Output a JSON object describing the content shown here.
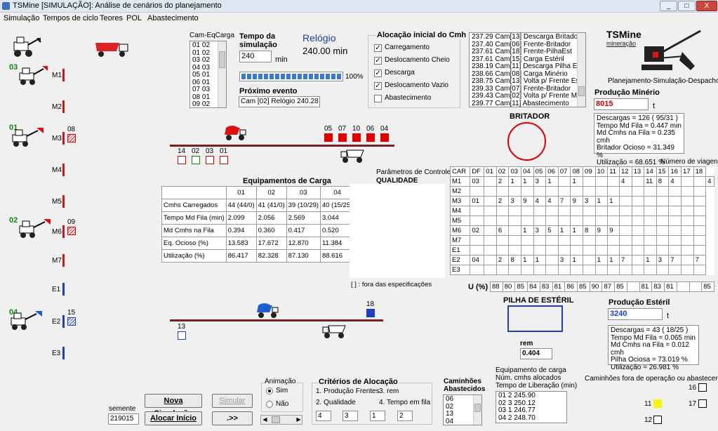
{
  "window": {
    "title": "TSMine [SIMULAÇÃO]: Análise de cenários do planejamento",
    "controls": [
      "_",
      "□",
      "X"
    ]
  },
  "menu": [
    "Simulação",
    "Tempos de ciclo",
    "Teores",
    "POL",
    "Abastecimento"
  ],
  "equip_rows": [
    "M1",
    "M2",
    "M3",
    "M4",
    "M5",
    "M6",
    "M7",
    "E1",
    "E2",
    "E3"
  ],
  "loaders": [
    {
      "id": "03",
      "color": "#0a8a0a"
    },
    {
      "id": "01",
      "color": "#0a8a0a"
    },
    {
      "id": "02",
      "color": "#0a8a0a"
    },
    {
      "id": "04",
      "color": "#0a8a0a"
    }
  ],
  "queue_labels": {
    "m3": "08",
    "m6": "09",
    "e2": "15"
  },
  "cam_eq": {
    "label": "Cam-EqCarga",
    "rows": [
      "01    02",
      "01    02",
      "03    02",
      "04    03",
      "05    01",
      "06    01",
      "07    03",
      "08    01",
      "09    02"
    ]
  },
  "tempo": {
    "label1": "Tempo da",
    "label2": "simulação",
    "value": "240",
    "unit": "min",
    "progress": 100,
    "progress_label": "100%"
  },
  "relogio": {
    "label": "Relógio",
    "value": "240.00 min"
  },
  "proximo": {
    "label": "Próximo evento",
    "value": "Cam [02]    Relógio 240.28"
  },
  "alocacao": {
    "title": "Alocação inicial do Cmh",
    "items": [
      {
        "label": "Carregamento",
        "checked": true
      },
      {
        "label": "Deslocamento Cheio",
        "checked": true
      },
      {
        "label": "Descarga",
        "checked": true
      },
      {
        "label": "Deslocamento Vazio",
        "checked": true
      },
      {
        "label": "Abastecimento",
        "checked": false
      }
    ]
  },
  "events": [
    "237.29  Cam[13]  Descarga Britador",
    "237.40  Cam[06]  Frente-Britador",
    "237.61  Cam[18]  Frente-PilhaEst",
    "237.61  Cam[15]  Carga Estéril",
    "238.19  Cam[11]  Descarga Pilha Est",
    "238.66  Cam[08]  Carga Minério",
    "238.75  Cam[13]  Volta p/ Frente Est",
    "239.33  Cam[07]  Frente-Britador",
    "239.43  Cam[02]  Volta p/ Frente Min",
    "239.77  Cam[11]  Abastecimento"
  ],
  "logo": {
    "name": "TSMine",
    "sub": "mineração",
    "tagline": "Planejamento-Simulação-Despacho"
  },
  "producao_minerio": {
    "label": "Produção Minério",
    "value": "8015",
    "unit": "t",
    "stats": [
      "Descargas = 126   ( 95/31 )",
      "Tempo Md Fila =  0.447 min",
      "Md Cmhs na Fila =  0.235 cmh",
      "Britador Ocioso = 31.349 %",
      "Utilização = 68.651 %"
    ]
  },
  "britador": {
    "label": "BRITADOR"
  },
  "top_queue": {
    "right": [
      "05",
      "07",
      "10",
      "06",
      "04"
    ],
    "left": [
      "14",
      "02",
      "03",
      "01"
    ]
  },
  "bottom_queue": {
    "right": [
      "18"
    ],
    "left": [
      "13"
    ]
  },
  "equip_carga": {
    "title": "Equipamentos de Carga",
    "cols": [
      "01",
      "02",
      "03",
      "04"
    ],
    "rows": [
      {
        "label": "Cmhs Carregados",
        "vals": [
          "44 (44/0)",
          "41 (41/0)",
          "39 (10/29)",
          "40 (15/25)"
        ]
      },
      {
        "label": "Tempo Md Fila (min)",
        "vals": [
          "2.099",
          "2.056",
          "2.569",
          "3.044"
        ]
      },
      {
        "label": "Md Cmhs na Fila",
        "vals": [
          "0.394",
          "0.360",
          "0.417",
          "0.520"
        ]
      },
      {
        "label": "Eq. Ocioso (%)",
        "vals": [
          "13.583",
          "17.672",
          "12.870",
          "11.384"
        ]
      },
      {
        "label": "Utilização (%)",
        "vals": [
          "86.417",
          "82.328",
          "87.130",
          "88.616"
        ]
      }
    ]
  },
  "parametros": {
    "label": "Parâmetros de Controle",
    "sub": "QUALIDADE",
    "note": "[  ] : fora das especificações"
  },
  "viagens": {
    "label": "Número de viagens",
    "head": [
      "CAR",
      "DF",
      "01",
      "02",
      "03",
      "04",
      "05",
      "06",
      "07",
      "08",
      "09",
      "10",
      "11",
      "12",
      "13",
      "14",
      "15",
      "16",
      "17",
      "18"
    ],
    "rows": [
      [
        "M1",
        "03",
        "",
        "2",
        "1",
        "1",
        "3",
        "1",
        "",
        "1",
        "",
        "",
        "",
        "4",
        "",
        "11",
        "8",
        "4",
        "",
        "",
        "4"
      ],
      [
        "M2",
        "",
        "",
        "",
        "",
        "",
        "",
        "",
        "",
        "",
        "",
        "",
        "",
        "",
        "",
        "",
        "",
        "",
        "",
        ""
      ],
      [
        "M3",
        "01",
        "",
        "2",
        "3",
        "9",
        "4",
        "4",
        "7",
        "9",
        "3",
        "1",
        "1",
        "",
        "",
        "",
        "",
        "",
        "",
        ""
      ],
      [
        "M4",
        "",
        "",
        "",
        "",
        "",
        "",
        "",
        "",
        "",
        "",
        "",
        "",
        "",
        "",
        "",
        "",
        "",
        "",
        ""
      ],
      [
        "M5",
        "",
        "",
        "",
        "",
        "",
        "",
        "",
        "",
        "",
        "",
        "",
        "",
        "",
        "",
        "",
        "",
        "",
        "",
        ""
      ],
      [
        "M6",
        "02",
        "",
        "6",
        "",
        "1",
        "3",
        "5",
        "1",
        "1",
        "8",
        "9",
        "9",
        "",
        "",
        "",
        "",
        "",
        "",
        ""
      ],
      [
        "M7",
        "",
        "",
        "",
        "",
        "",
        "",
        "",
        "",
        "",
        "",
        "",
        "",
        "",
        "",
        "",
        "",
        "",
        "",
        ""
      ],
      [
        "E1",
        "",
        "",
        "",
        "",
        "",
        "",
        "",
        "",
        "",
        "",
        "",
        "",
        "",
        "",
        "",
        "",
        "",
        "",
        ""
      ],
      [
        "E2",
        "04",
        "",
        "2",
        "8",
        "1",
        "1",
        "",
        "3",
        "1",
        "",
        "1",
        "1",
        "7",
        "",
        "1",
        "3",
        "7",
        "",
        "7"
      ],
      [
        "E3",
        "",
        "",
        "",
        "",
        "",
        "",
        "",
        "",
        "",
        "",
        "",
        "",
        "",
        "",
        "",
        "",
        "",
        "",
        ""
      ]
    ],
    "u_label": "U (%)",
    "u": [
      "88",
      "80",
      "85",
      "84",
      "83",
      "81",
      "86",
      "85",
      "90",
      "87",
      "85",
      "",
      "81",
      "83",
      "81",
      "",
      "",
      "85"
    ]
  },
  "pilha": {
    "label": "PILHA DE ESTÉRIL",
    "rem_label": "rem",
    "rem_value": "0.404"
  },
  "producao_esteril": {
    "label": "Produção Estéril",
    "value": "3240",
    "unit": "t",
    "stats": [
      "Descargas = 43   ( 18/25 )",
      "Tempo Md Fila =  0.065 min",
      "Md Cmhs na Fila =  0.012 cmh",
      "Pilha Ociosa = 73.019 %",
      "Utilização = 26.981 %"
    ]
  },
  "equip_carga_list": {
    "l1": "Equipamento de carga",
    "l2": "Núm. cmhs alocados",
    "l3": "Tempo de Liberação (min)",
    "rows": [
      "01  2   245.90",
      "02  3   250.12",
      "03  1   246.77",
      "04  2   248.70"
    ]
  },
  "fora_operacao": {
    "label": "Caminhões fora de operação ou abastecendo",
    "items": [
      "16",
      "11",
      "17",
      "12"
    ]
  },
  "semente": {
    "label": "semente",
    "value": "219015"
  },
  "buttons": {
    "nova": "Nova Simulação",
    "simular": "Simular",
    "alocar": "Alocar Início",
    "next": ".>>"
  },
  "animacao": {
    "label": "Animação",
    "sim": "Sim",
    "nao": "Não"
  },
  "criterios": {
    "title": "Critérios de Alocação",
    "c1": "1. Produção Frentes",
    "c3": "3. rem",
    "c2": "2. Qualidade",
    "c4": "4. Tempo em fila",
    "vals": [
      "4",
      "3",
      "1",
      "2"
    ]
  },
  "abastecidos": {
    "label1": "Caminhões",
    "label2": "Abastecidos",
    "rows": [
      "06",
      "02",
      "13",
      "04"
    ]
  }
}
